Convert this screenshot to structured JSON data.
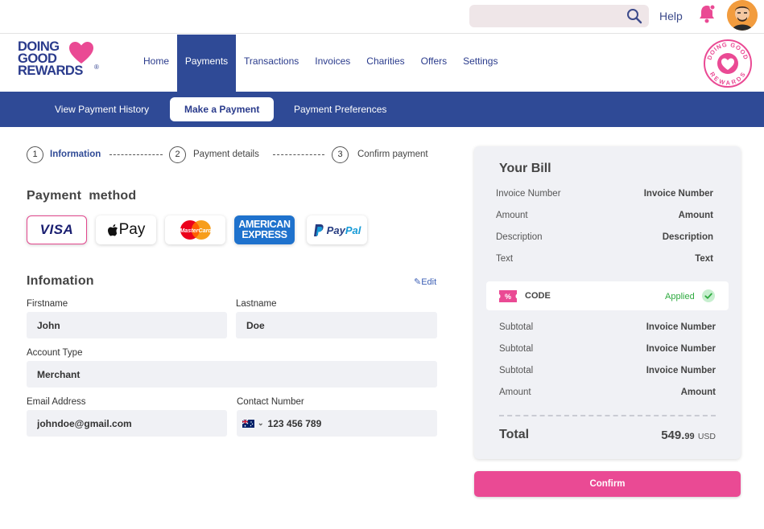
{
  "header": {
    "search": {
      "placeholder": ""
    },
    "help_label": "Help"
  },
  "brand": {
    "line1": "DOING",
    "line2": "GOOD",
    "line3": "REWARDS",
    "reg": "®",
    "badge_top": "DOING GOOD",
    "badge_bottom": "REWARDS",
    "color_primary": "#2a3b8c",
    "color_accent": "#ea4a94"
  },
  "nav": {
    "items": [
      {
        "label": "Home"
      },
      {
        "label": "Payments",
        "active": true
      },
      {
        "label": "Transactions"
      },
      {
        "label": "Invoices"
      },
      {
        "label": "Charities"
      },
      {
        "label": "Offers"
      },
      {
        "label": "Settings"
      }
    ]
  },
  "subnav": {
    "items": [
      {
        "label": "View Payment History"
      },
      {
        "label": "Make a Payment",
        "active": true
      },
      {
        "label": "Payment Preferences"
      }
    ]
  },
  "steps": [
    {
      "number": "1",
      "label": "Information",
      "active": true
    },
    {
      "number": "2",
      "label": "Payment details"
    },
    {
      "number": "3",
      "label": "Confirm payment"
    }
  ],
  "payment_method": {
    "title": "Payment  method",
    "options": [
      {
        "name": "VISA",
        "selected": true
      },
      {
        "name": "Pay"
      },
      {
        "name": "MasterCard"
      },
      {
        "name": "AMERICAN EXPRESS",
        "line1": "AMERICAN",
        "line2": "EXPRESS"
      },
      {
        "name": "PayPal",
        "part1": "Pay",
        "part2": "Pal"
      }
    ]
  },
  "information": {
    "title": "Infomation",
    "edit_label": "Edit",
    "firstname_label": "Firstname",
    "firstname": "John",
    "lastname_label": "Lastname",
    "lastname": "Doe",
    "account_type_label": "Account Type",
    "account_type": "Merchant",
    "email_label": "Email Address",
    "email": "johndoe@gmail.com",
    "contact_label": "Contact Number",
    "contact": "123 456 789"
  },
  "bill": {
    "title": "Your Bill",
    "rows": [
      {
        "label": "Invoice Number",
        "value": "Invoice Number"
      },
      {
        "label": "Amount",
        "value": "Amount"
      },
      {
        "label": "Description",
        "value": "Description"
      },
      {
        "label": "Text",
        "value": "Text"
      }
    ],
    "code": {
      "label": "CODE",
      "status": "Applied"
    },
    "summary": [
      {
        "label": "Subtotal",
        "value": "Invoice Number"
      },
      {
        "label": "Subtotal",
        "value": "Invoice Number"
      },
      {
        "label": "Subtotal",
        "value": "Invoice Number"
      },
      {
        "label": "Amount",
        "value": "Amount"
      }
    ],
    "total_label": "Total",
    "total_main": "549.",
    "total_cents": "99",
    "currency": "USD"
  },
  "confirm_label": "Confirm"
}
